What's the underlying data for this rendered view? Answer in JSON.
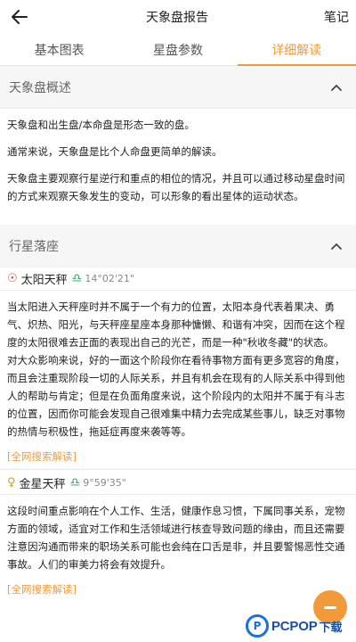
{
  "header": {
    "title": "天象盘报告",
    "right_action": "笔记",
    "back_icon": "back-arrow-icon"
  },
  "tabs": [
    {
      "label": "基本图表",
      "active": false
    },
    {
      "label": "星盘参数",
      "active": false
    },
    {
      "label": "详细解读",
      "active": true
    }
  ],
  "overview": {
    "title": "天象盘概述",
    "paragraphs": [
      "天象盘和出生盘/本命盘是形态一致的盘。",
      "通常来说，天象盘是比个人命盘更简单的解读。",
      "天象盘主要观察行星逆行和重点的相位的情况，并且可以通过移动星盘时间的方式来观察天象发生的变动，可以形象的看出星体的运动状态。"
    ]
  },
  "placements": {
    "title": "行星落座",
    "items": [
      {
        "planet_symbol": "☉",
        "name": "太阳天秤",
        "sign_symbol": "♎",
        "degree": "14°02'21\"",
        "text_1": "当太阳进入天秤座时并不属于一个有力的位置，太阳本身代表着果决、勇气、炽热、阳光，与天秤座星座本身那种慵懒、和谐有冲突，因而在这个程度的太阳很难去正面的表现出自己的光芒，而是一种\"秋收冬藏\"的状态。",
        "text_2": "对大众影响来说，好的一面这个阶段你在看待事物方面有更多宽容的角度，而且会注重现阶段一切的人际关系，并且有机会在现有的人际关系中得到他人的帮助与肯定；但是在负面角度来说，这个阶段内的太阳并不属于有斗志的位置，因而你可能会发现自己很难集中精力去完成某些事儿，缺乏对事物的热情与积极性，拖延症再度来袭等等。",
        "link": "[全网搜索解读]"
      },
      {
        "planet_symbol": "♀",
        "name": "金星天秤",
        "sign_symbol": "♎",
        "degree": "9°59'35\"",
        "text_1": "这段时间重点影响在个人工作、生活，健康作息习惯，下属同事关系，宠物方面的领域，适宜对工作和生活领域进行核查导致问题的缘由，而且还需要注意因沟通而带来的职场关系可能也会纯在口舌是非，并且要警惕恶性交通事故。人们的审美力将会有效提升。",
        "link": "[全网搜索解读]"
      }
    ]
  },
  "watermark": {
    "logo_letter": "P",
    "brand": "PCPOP",
    "suffix": "下载"
  },
  "colors": {
    "accent": "#f29a3a",
    "sun": "#d9342b",
    "venus": "#c9a227",
    "libra": "#2c9e5a"
  }
}
